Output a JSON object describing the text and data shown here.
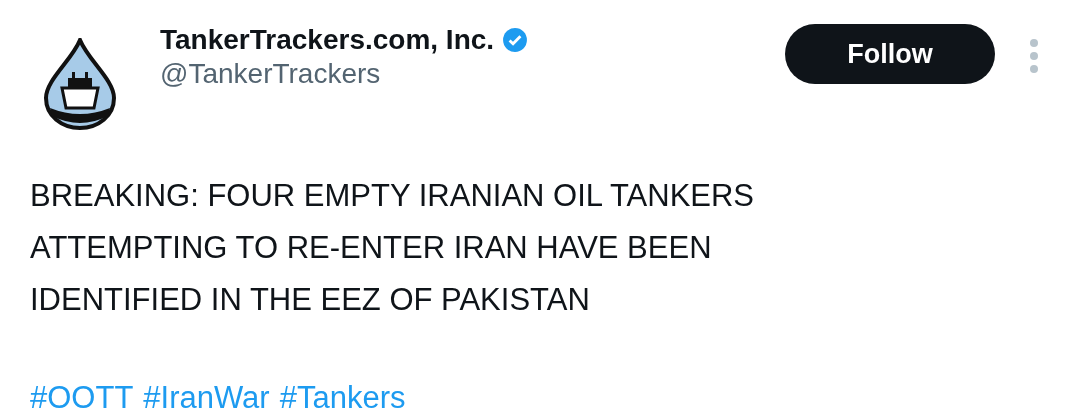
{
  "author": {
    "name": "TankerTrackers.com, Inc.",
    "verified": true,
    "handle": "@TankerTrackers"
  },
  "follow_button": {
    "label": "Follow"
  },
  "text_lines": [
    "BREAKING: FOUR EMPTY IRANIAN OIL TANKERS",
    "ATTEMPTING TO RE-ENTER IRAN HAVE BEEN",
    "IDENTIFIED IN THE EEZ OF PAKISTAN"
  ],
  "hashtags": [
    "#OOTT",
    "#IranWar",
    "#Tankers"
  ]
}
